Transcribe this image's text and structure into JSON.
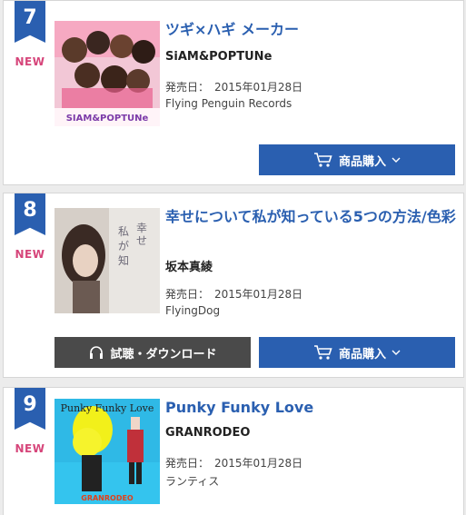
{
  "entries": [
    {
      "rank": "7",
      "badge": "NEW",
      "title": "ツギ×ハギ メーカー",
      "artist": "SiAM&POPTUNe",
      "release_label": "発売日：",
      "release_date": "2015年01月28日",
      "label": "Flying Penguin Records",
      "buy_label": "商品購入",
      "jacket_text": "SIAM&POPTUNe"
    },
    {
      "rank": "8",
      "badge": "NEW",
      "title": "幸せについて私が知っている5つの方法/色彩",
      "artist": "坂本真綾",
      "release_label": "発売日：",
      "release_date": "2015年01月28日",
      "label": "FlyingDog",
      "listen_label": "試聴・ダウンロード",
      "buy_label": "商品購入"
    },
    {
      "rank": "9",
      "badge": "NEW",
      "title": "Punky Funky Love",
      "artist": "GRANRODEO",
      "release_label": "発売日：",
      "release_date": "2015年01月28日",
      "label": "ランティス",
      "jacket_title": "Punky Funky Love",
      "jacket_text": "GRANRODEO"
    }
  ],
  "colors": {
    "accent": "#2a5fb0",
    "new_badge": "#d6457a",
    "listen_button": "#4a4a4a"
  }
}
